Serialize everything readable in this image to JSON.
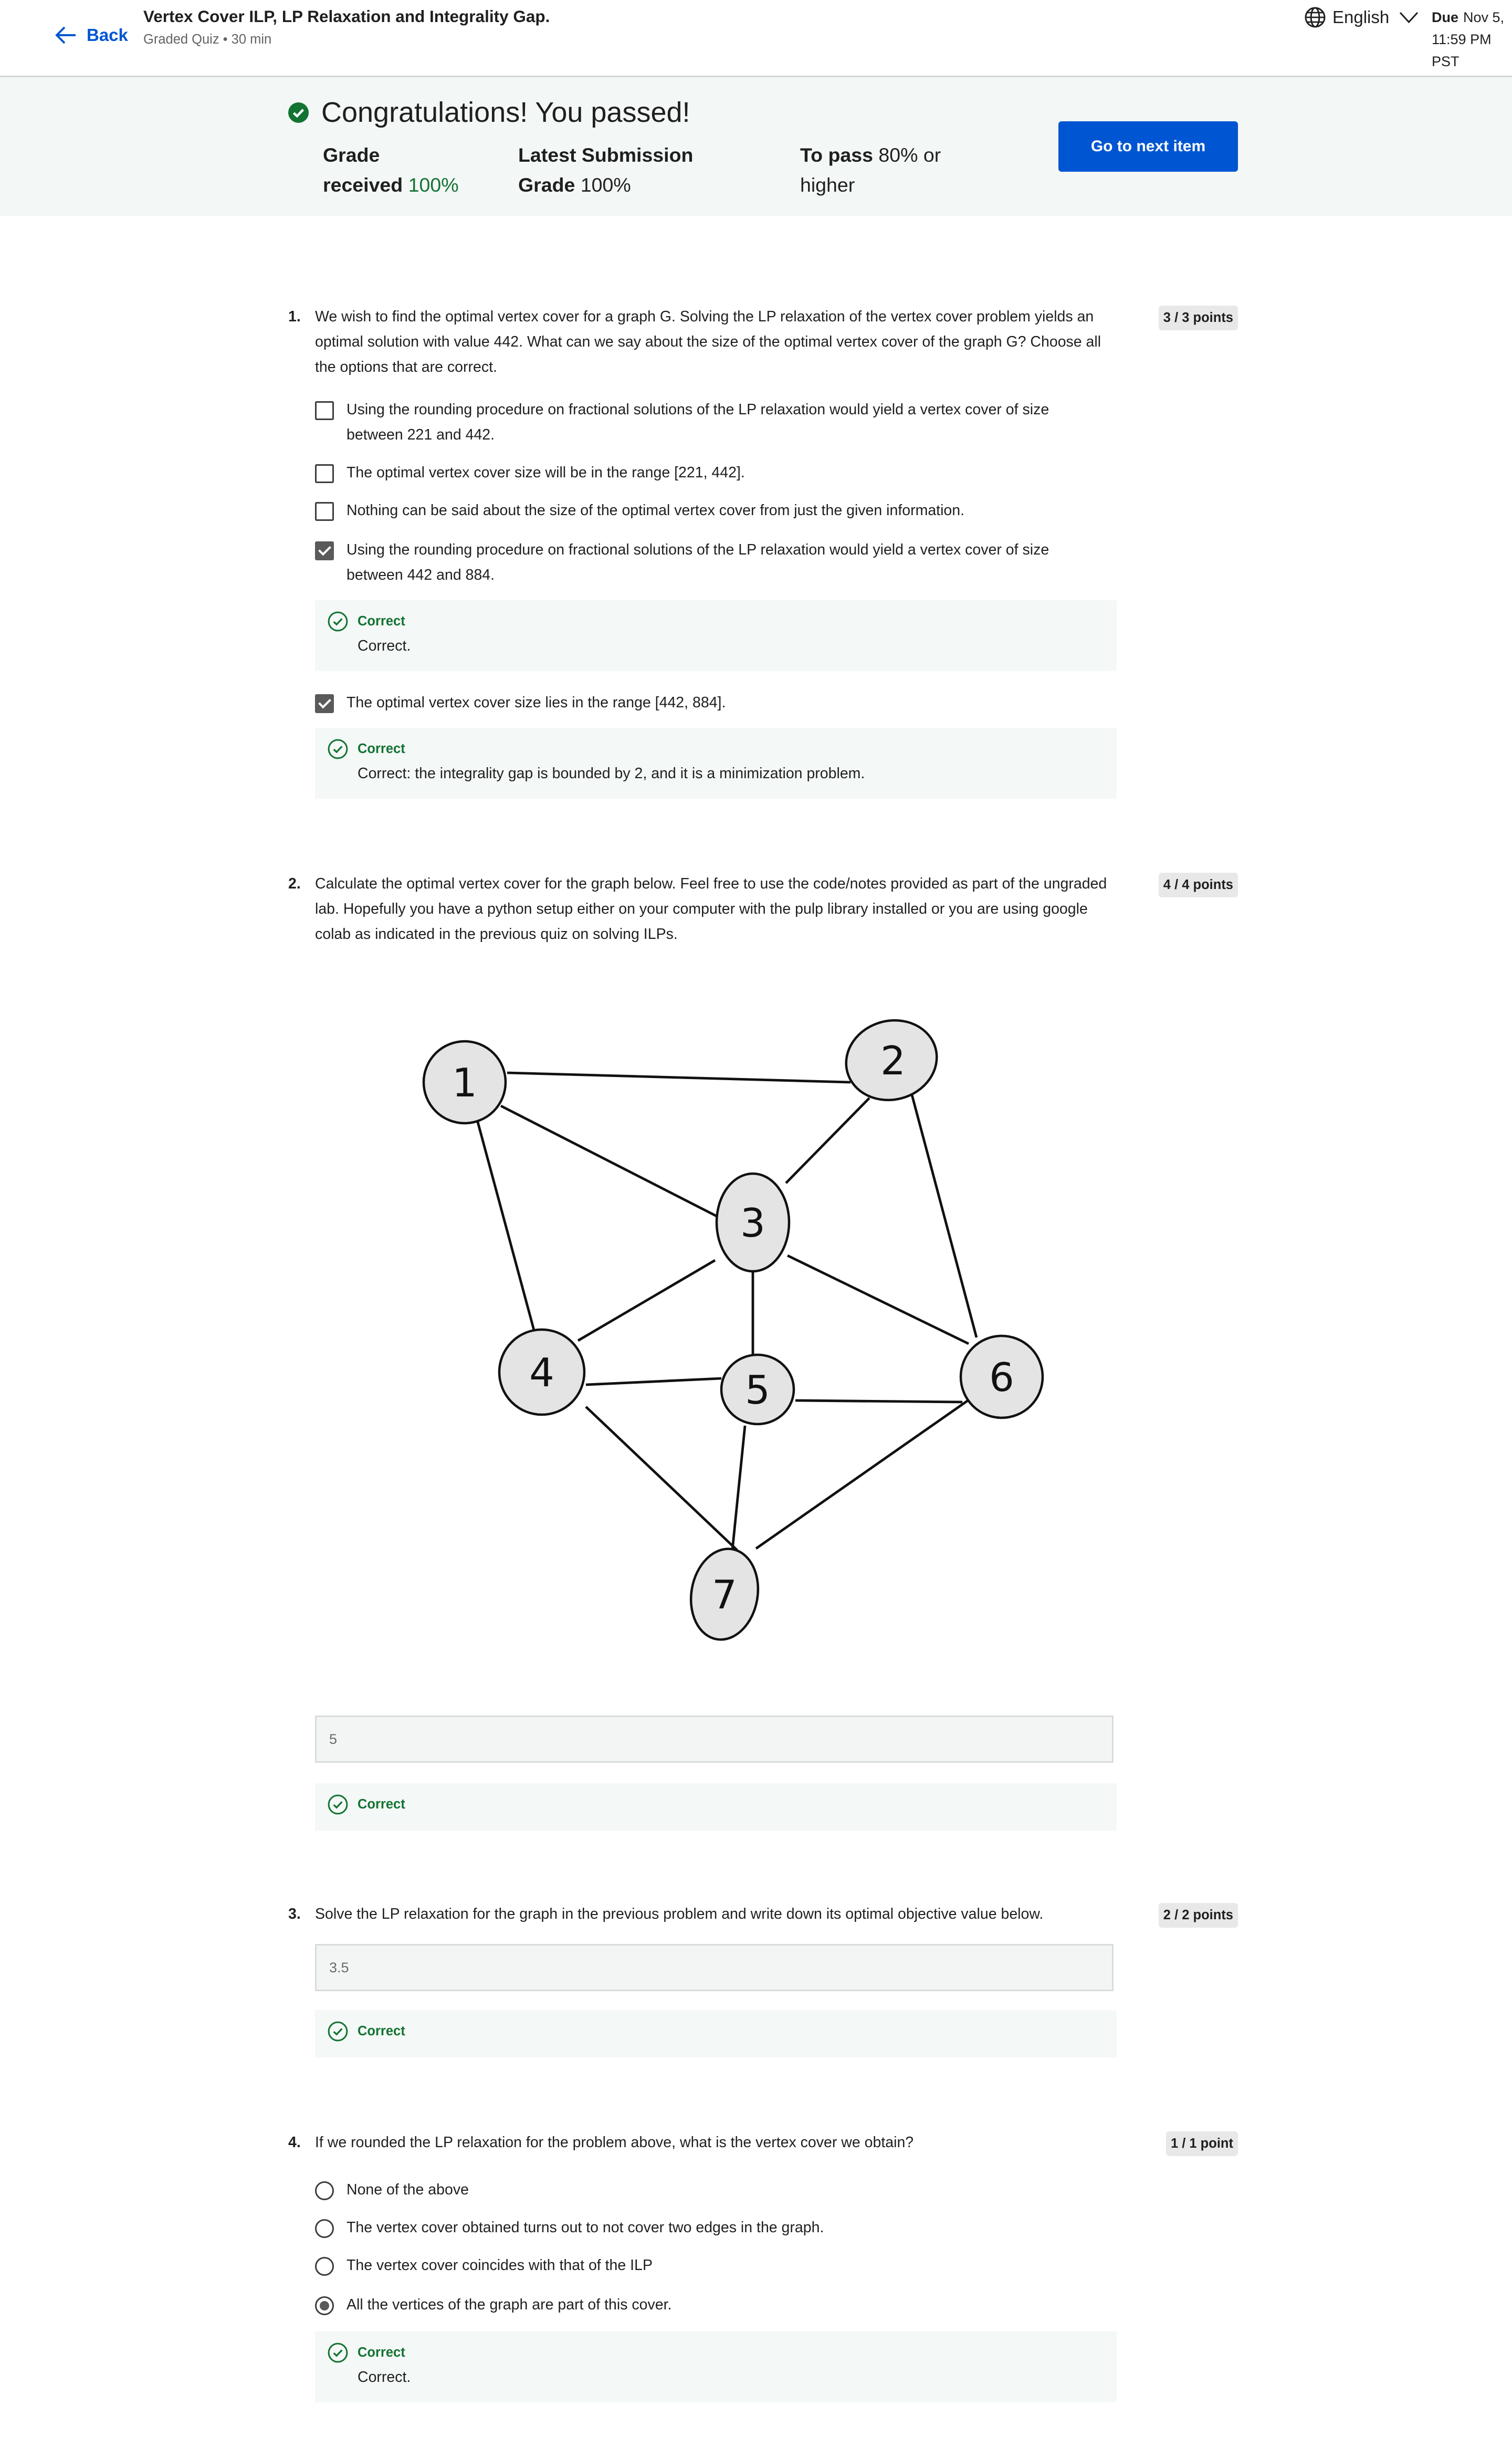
{
  "header": {
    "back_label": "Back",
    "title": "Vertex Cover ILP, LP Relaxation and Integrality Gap.",
    "subtitle": "Graded Quiz • 30 min",
    "language": "English",
    "due_label": "Due",
    "due_date": "Nov 5,",
    "due_time": "11:59 PM PST"
  },
  "banner": {
    "message": "Congratulations! You passed!",
    "grade_label_1": "Grade",
    "grade_label_2": "received",
    "grade_value": "100%",
    "latest_label_1": "Latest Submission",
    "latest_label_2": "Grade",
    "latest_value": "100%",
    "pass_label": "To pass",
    "pass_value": "80% or",
    "pass_value_2": "higher",
    "next_button": "Go to next item"
  },
  "colors": {
    "accent": "#0056d2",
    "correct": "#137333",
    "banner_bg": "#f3f7f6"
  },
  "questions": [
    {
      "number": "1.",
      "points": "3 / 3 points",
      "text": "We wish to find the optimal vertex cover for a graph G. Solving the LP relaxation of the vertex cover problem yields an optimal solution with value 442. What can we say about the size of the optimal vertex cover of the graph G? Choose all the options that are correct.",
      "options": [
        {
          "label": "Using the rounding procedure on fractional solutions of the LP relaxation would yield a vertex cover of size between 221 and 442.",
          "checked": false
        },
        {
          "label": "The optimal vertex cover size will be in the range [221, 442].",
          "checked": false
        },
        {
          "label": "Nothing can be said about the size of the optimal vertex cover from just the given information.",
          "checked": false
        },
        {
          "label": "Using the rounding procedure on fractional solutions of the LP relaxation would yield a vertex cover of size between 442 and 884.",
          "checked": true
        },
        {
          "label": "The optimal vertex cover size lies in the range [442, 884].",
          "checked": true
        }
      ],
      "feedback": [
        {
          "status": "Correct",
          "text": "Correct."
        },
        {
          "status": "Correct",
          "text": "Correct: the integrality gap is bounded by 2, and it is a minimization problem."
        }
      ]
    },
    {
      "number": "2.",
      "points": "4 / 4 points",
      "text": "Calculate the optimal vertex cover for the graph below. Feel free to use the code/notes provided as part of the ungraded lab. Hopefully you have a python setup either on your computer with the pulp library installed or you are using google colab as indicated in the previous quiz on solving ILPs.",
      "graph": {
        "nodes": [
          "1",
          "2",
          "3",
          "4",
          "5",
          "6",
          "7"
        ],
        "edges": [
          [
            "1",
            "2"
          ],
          [
            "1",
            "3"
          ],
          [
            "1",
            "4"
          ],
          [
            "2",
            "3"
          ],
          [
            "2",
            "6"
          ],
          [
            "3",
            "4"
          ],
          [
            "3",
            "5"
          ],
          [
            "3",
            "6"
          ],
          [
            "4",
            "5"
          ],
          [
            "4",
            "7"
          ],
          [
            "5",
            "6"
          ],
          [
            "5",
            "7"
          ],
          [
            "6",
            "7"
          ]
        ]
      },
      "answer": "5",
      "feedback": {
        "status": "Correct"
      }
    },
    {
      "number": "3.",
      "points": "2 / 2 points",
      "text": "Solve the LP relaxation for the graph in the previous problem and write down its optimal objective value below.",
      "answer": "3.5",
      "feedback": {
        "status": "Correct"
      }
    },
    {
      "number": "4.",
      "points": "1 / 1 point",
      "text": "If we rounded the LP relaxation for the problem above, what is the vertex cover we obtain?",
      "options": [
        {
          "label": "None of the above",
          "selected": false
        },
        {
          "label": "The vertex cover obtained turns out to not cover two edges in the graph.",
          "selected": false
        },
        {
          "label": "The vertex cover coincides with that of the ILP",
          "selected": false
        },
        {
          "label": "All the vertices of the graph are part of this cover.",
          "selected": true
        }
      ],
      "feedback": {
        "status": "Correct",
        "text": "Correct."
      }
    }
  ]
}
